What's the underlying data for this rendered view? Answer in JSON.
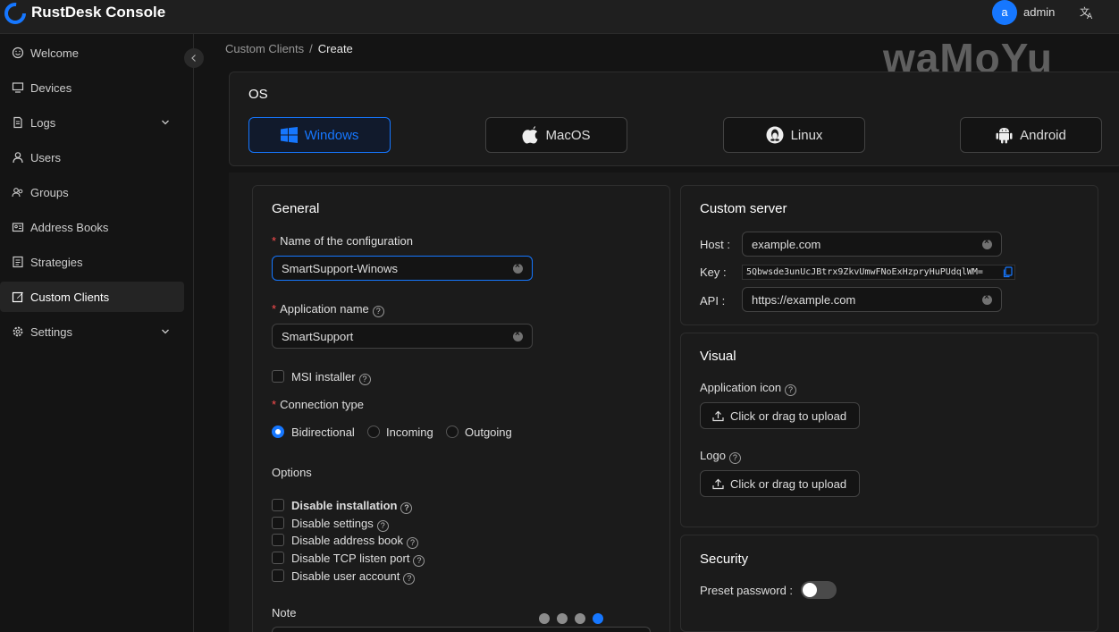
{
  "app": {
    "title": "RustDesk Console",
    "user_initial": "a",
    "username": "admin"
  },
  "sidebar": {
    "items": [
      {
        "label": "Welcome",
        "icon": "smile-icon"
      },
      {
        "label": "Devices",
        "icon": "desktop-icon"
      },
      {
        "label": "Logs",
        "icon": "file-icon"
      },
      {
        "label": "Users",
        "icon": "user-icon"
      },
      {
        "label": "Groups",
        "icon": "team-icon"
      },
      {
        "label": "Address Books",
        "icon": "contacts-icon"
      },
      {
        "label": "Strategies",
        "icon": "profile-icon"
      },
      {
        "label": "Custom Clients",
        "icon": "edit-icon"
      },
      {
        "label": "Settings",
        "icon": "gear-icon"
      }
    ]
  },
  "breadcrumb": {
    "parent": "Custom Clients",
    "separator": "/",
    "current": "Create"
  },
  "watermark": "waMoYu",
  "os": {
    "title": "OS",
    "options": [
      "Windows",
      "MacOS",
      "Linux",
      "Android"
    ],
    "selected": "Windows"
  },
  "general": {
    "title": "General",
    "config_name_label": "Name of the configuration",
    "config_name_value": "SmartSupport-Winows",
    "app_name_label": "Application name",
    "app_name_value": "SmartSupport",
    "msi_label": "MSI installer",
    "connection_type_label": "Connection type",
    "connection_types": [
      "Bidirectional",
      "Incoming",
      "Outgoing"
    ],
    "connection_selected": "Bidirectional",
    "options_label": "Options",
    "options": [
      "Disable installation",
      "Disable settings",
      "Disable address book",
      "Disable TCP listen port",
      "Disable user account"
    ],
    "note_label": "Note"
  },
  "custom_server": {
    "title": "Custom server",
    "host_label": "Host :",
    "host_value": "example.com",
    "key_label": "Key :",
    "key_value": "5Qbwsde3unUcJBtrx9ZkvUmwFNoExHzpryHuPUdqlWM=",
    "api_label": "API :",
    "api_value": "https://example.com"
  },
  "visual": {
    "title": "Visual",
    "app_icon_label": "Application icon",
    "upload_label": "Click or drag to upload",
    "logo_label": "Logo"
  },
  "security": {
    "title": "Security",
    "preset_password_label": "Preset password :",
    "preset_password_on": false
  },
  "carousel": {
    "count": 4,
    "active_index": 3
  },
  "colors": {
    "accent": "#1677ff",
    "background": "#141414",
    "card": "#1b1b1b"
  }
}
